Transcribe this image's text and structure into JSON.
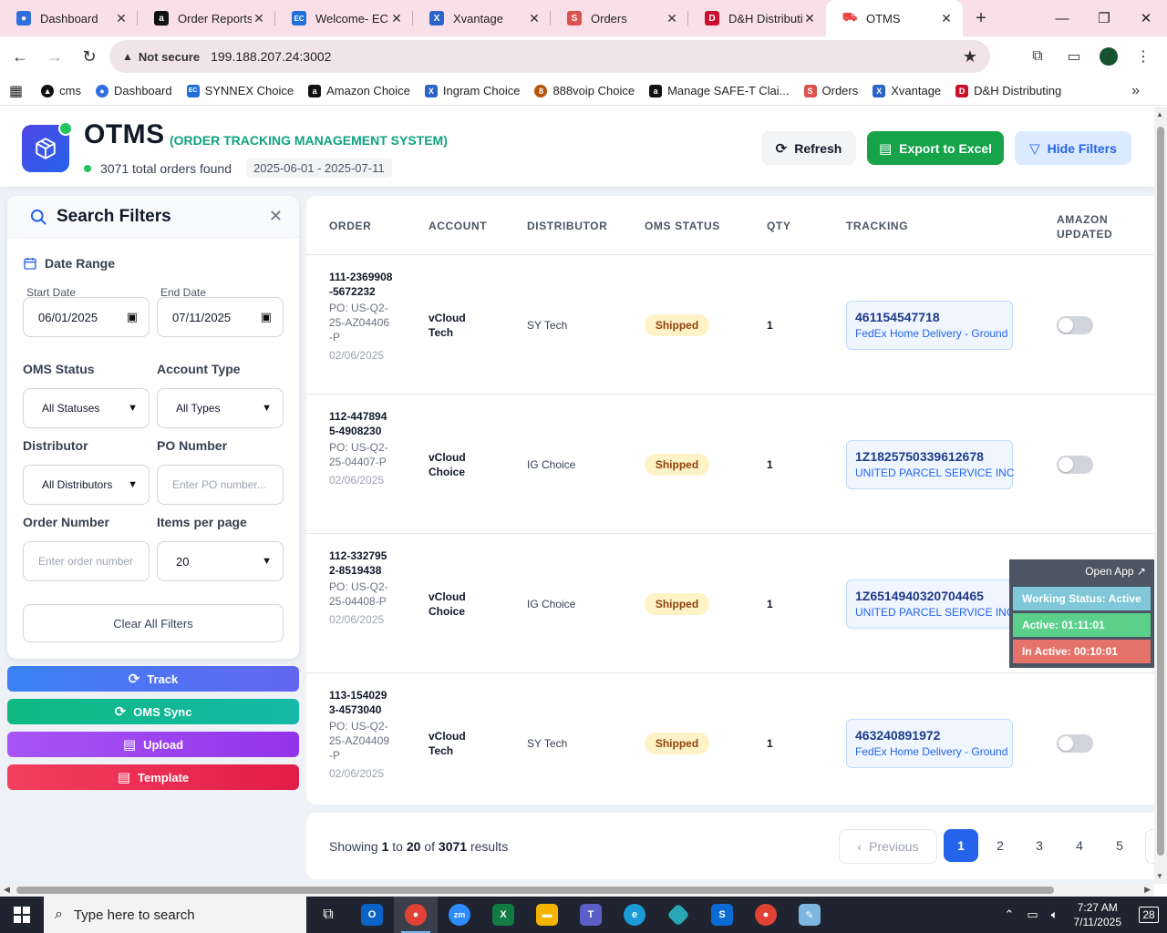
{
  "browser": {
    "tabs": [
      {
        "label": "Dashboard",
        "color": "#2f6fde",
        "glyph": "●"
      },
      {
        "label": "Order Reports",
        "color": "#111111",
        "glyph": "a"
      },
      {
        "label": "Welcome- ECE",
        "color": "#1e6fd9",
        "glyph": "EC"
      },
      {
        "label": "Xvantage",
        "color": "#2a64c6",
        "glyph": "X"
      },
      {
        "label": "Orders",
        "color": "#d9534f",
        "glyph": "S"
      },
      {
        "label": "D&H Distributi",
        "color": "#c8102e",
        "glyph": "D"
      },
      {
        "label": "OTMS",
        "color": "#ef4444",
        "glyph": "⛟"
      }
    ],
    "address": {
      "security_label": "Not secure",
      "url": "199.188.207.24:3002"
    },
    "profile_initial": "f",
    "bookmarks": [
      {
        "label": "cms",
        "color": "#111111"
      },
      {
        "label": "Dashboard",
        "color": "#2f6fde"
      },
      {
        "label": "SYNNEX Choice",
        "color": "#1e6fd9"
      },
      {
        "label": "Amazon Choice",
        "color": "#111111"
      },
      {
        "label": "Ingram Choice",
        "color": "#2a64c6"
      },
      {
        "label": "888voip Choice",
        "color": "#b45309"
      },
      {
        "label": "Manage SAFE-T Clai...",
        "color": "#111111"
      },
      {
        "label": "Orders",
        "color": "#d9534f"
      },
      {
        "label": "Xvantage",
        "color": "#2a64c6"
      },
      {
        "label": "D&H Distributing",
        "color": "#c8102e"
      }
    ]
  },
  "header": {
    "title": "OTMS",
    "subtitle": "(ORDER TRACKING MANAGEMENT SYSTEM)",
    "order_count": "3071 total orders found",
    "date_range": "2025-06-01 - 2025-07-11",
    "refresh_label": "Refresh",
    "export_label": "Export to Excel",
    "hide_filters_label": "Hide Filters"
  },
  "filters": {
    "title": "Search Filters",
    "date_range_label": "Date Range",
    "start_date_label": "Start Date",
    "start_date_value": "06/01/2025",
    "end_date_label": "End Date",
    "end_date_value": "07/11/2025",
    "oms_status_label": "OMS Status",
    "oms_status_value": "All Statuses",
    "account_type_label": "Account Type",
    "account_type_value": "All Types",
    "distributor_label": "Distributor",
    "distributor_value": "All Distributors",
    "po_number_label": "PO Number",
    "po_number_placeholder": "Enter PO number...",
    "order_number_label": "Order Number",
    "order_number_placeholder": "Enter order number",
    "items_per_page_label": "Items per page",
    "items_per_page_value": "20",
    "clear_label": "Clear All Filters"
  },
  "actions": {
    "track": "Track",
    "oms_sync": "OMS Sync",
    "upload": "Upload",
    "template": "Template"
  },
  "table": {
    "headers": {
      "order": "ORDER",
      "account": "ACCOUNT",
      "distributor": "DISTRIBUTOR",
      "oms_status": "OMS STATUS",
      "qty": "QTY",
      "tracking": "TRACKING",
      "amazon_updated_1": "AMAZON",
      "amazon_updated_2": "UPDATED"
    },
    "rows": [
      {
        "order_number": "111-2369908-5672232",
        "po": "PO: US-Q2-25-AZ04406-P",
        "date": "02/06/2025",
        "account": "vCloud Tech",
        "distributor": "SY Tech",
        "status": "Shipped",
        "qty": "1",
        "tracking_number": "461154547718",
        "carrier": "FedEx Home Delivery - Ground"
      },
      {
        "order_number": "112-4478945-4908230",
        "po": "PO: US-Q2-25-04407-P",
        "date": "02/06/2025",
        "account": "vCloud Choice",
        "distributor": "IG Choice",
        "status": "Shipped",
        "qty": "1",
        "tracking_number": "1Z1825750339612678",
        "carrier": "UNITED PARCEL SERVICE INC"
      },
      {
        "order_number": "112-3327952-8519438",
        "po": "PO: US-Q2-25-04408-P",
        "date": "02/06/2025",
        "account": "vCloud Choice",
        "distributor": "IG Choice",
        "status": "Shipped",
        "qty": "1",
        "tracking_number": "1Z6514940320704465",
        "carrier": "UNITED PARCEL SERVICE INC"
      },
      {
        "order_number": "113-1540293-4573040",
        "po": "PO: US-Q2-25-AZ04409-P",
        "date": "02/06/2025",
        "account": "vCloud Tech",
        "distributor": "SY Tech",
        "status": "Shipped",
        "qty": "1",
        "tracking_number": "463240891972",
        "carrier": "FedEx Home Delivery - Ground"
      }
    ]
  },
  "pagination": {
    "showing_prefix": "Showing",
    "from": "1",
    "to_word": "to",
    "to": "20",
    "of_word": "of",
    "total": "3071",
    "results_word": "results",
    "previous": "Previous",
    "pages": [
      "1",
      "2",
      "3",
      "4",
      "5"
    ]
  },
  "widget": {
    "open_app": "Open App ↗",
    "working_status": "Working Status: Active",
    "active": "Active: 01:11:01",
    "inactive": "In Active: 00:10:01"
  },
  "taskbar": {
    "search_placeholder": "Type here to search",
    "time": "7:27 AM",
    "date": "7/11/2025",
    "notifications": "28"
  },
  "colors": {
    "primary": "#2563eb",
    "success": "#16a34a",
    "accent_teal": "#10a37f",
    "status_shipped_bg": "#fef3c7"
  }
}
